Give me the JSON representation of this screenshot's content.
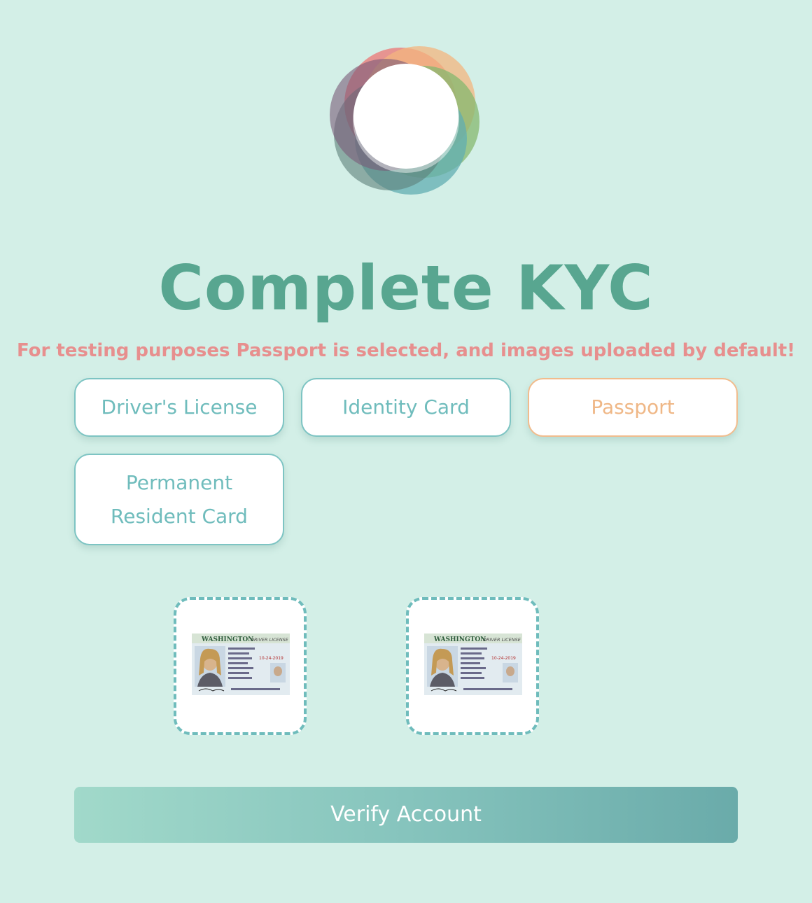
{
  "brand": {
    "logo_icon": "multicolor-ring-logo-icon"
  },
  "header": {
    "title": "Complete KYC",
    "notice": "For testing purposes Passport is selected, and images uploaded by default!"
  },
  "document_types": [
    {
      "label": "Driver's License",
      "selected": false
    },
    {
      "label": "Identity Card",
      "selected": false
    },
    {
      "label": "Passport",
      "selected": true
    },
    {
      "label": "Permanent Resident Card",
      "selected": false
    }
  ],
  "uploads": [
    {
      "state": "Washington driver license image uploaded",
      "card_state": "WASHINGTON",
      "card_type": "DRIVER LICENSE",
      "card_issue": "10-24-2019"
    },
    {
      "state": "Washington driver license image uploaded",
      "card_state": "WASHINGTON",
      "card_type": "DRIVER LICENSE",
      "card_issue": "10-24-2019"
    }
  ],
  "actions": {
    "verify_label": "Verify Account"
  },
  "colors": {
    "background": "#d3efe7",
    "title": "#58a690",
    "notice": "#e78f8e",
    "button_border": "#7dc4c3",
    "selected_border": "#f1bc8d"
  }
}
